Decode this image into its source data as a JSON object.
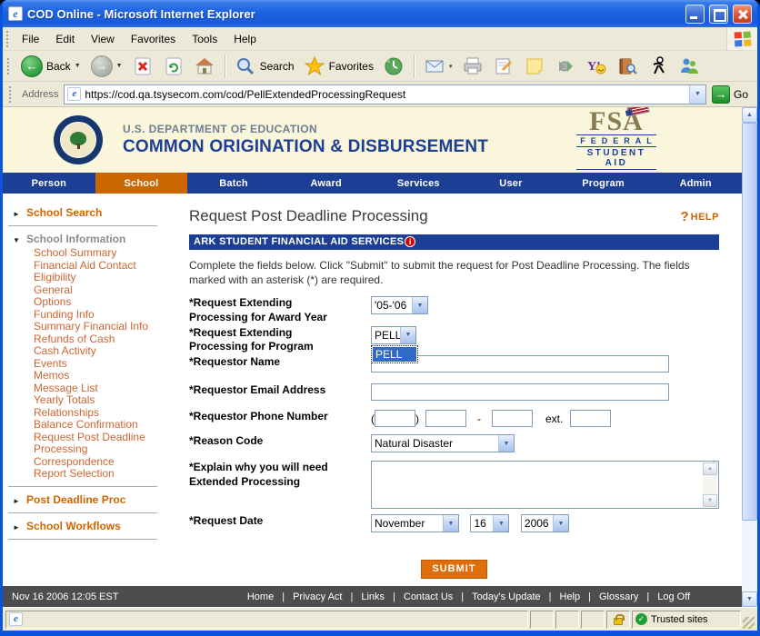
{
  "icons": {
    "chevron_down": "▼",
    "arrow_up": "▲",
    "arrow_down": "▼",
    "arrow_right": "►",
    "dropdown_small": "▾",
    "back_arrow": "←",
    "forward_arrow": "→",
    "go_arrow": "→",
    "check": "✓",
    "info_glyph": "i",
    "help_glyph": "?",
    "ie_glyph": "e"
  },
  "colors": {
    "nav_blue": "#1C3E94",
    "accent_orange": "#CC6600",
    "submit_orange": "#DF6E0B",
    "selection_blue": "#316AC5",
    "footer_gray": "#4D4D4D",
    "banner_cream": "#FAF6DC"
  },
  "window": {
    "title": "COD Online - Microsoft Internet Explorer",
    "menu": [
      "File",
      "Edit",
      "View",
      "Favorites",
      "Tools",
      "Help"
    ],
    "toolbar": {
      "back_label": "Back",
      "search_label": "Search",
      "favorites_label": "Favorites"
    },
    "address": {
      "label": "Address",
      "value": "https://cod.qa.tsysecom.com/cod/PellExtendedProcessingRequest",
      "go_label": "Go"
    },
    "status": {
      "trusted_label": "Trusted sites"
    }
  },
  "banner": {
    "dept": "U.S. DEPARTMENT OF EDUCATION",
    "app": "COMMON ORIGINATION & DISBURSEMENT",
    "fsa_acronym": "FSA",
    "fsa_line1": "FEDERAL",
    "fsa_line2": "STUDENT AID"
  },
  "nav": {
    "items": [
      {
        "label": "Person"
      },
      {
        "label": "School",
        "active": true
      },
      {
        "label": "Batch"
      },
      {
        "label": "Award"
      },
      {
        "label": "Services"
      },
      {
        "label": "User"
      },
      {
        "label": "Program"
      },
      {
        "label": "Admin"
      }
    ]
  },
  "sidebar": {
    "sections": [
      {
        "label": "School Search",
        "expanded": false
      },
      {
        "label": "School Information",
        "expanded": true,
        "items": [
          "School Summary",
          "Financial Aid Contact",
          "Eligibility",
          "General",
          "Options",
          "Funding Info",
          "Summary Financial Info",
          "Refunds of Cash",
          "Cash Activity",
          "Events",
          "Memos",
          "Message List",
          "Yearly Totals",
          "Relationships",
          "Balance Confirmation",
          "Request Post Deadline Processing",
          "Correspondence",
          "Report Selection"
        ]
      },
      {
        "label": "Post Deadline Proc",
        "expanded": false
      },
      {
        "label": "School Workflows",
        "expanded": false
      }
    ]
  },
  "main": {
    "page_title": "Request Post Deadline Processing",
    "help_label": "HELP",
    "school_banner": "ARK STUDENT FINANCIAL AID SERVICES",
    "instructions": "Complete the fields below. Click \"Submit\" to submit the request for Post Deadline Processing. The fields marked with an asterisk (*) are required.",
    "fields": {
      "award_year": {
        "label": "*Request Extending Processing for Award Year",
        "value": "'05-'06"
      },
      "program": {
        "label": "*Request Extending Processing for Program",
        "value": "PELL",
        "open_option": "PELL"
      },
      "requestor_name": {
        "label": "*Requestor Name",
        "value": ""
      },
      "requestor_email": {
        "label": "*Requestor Email Address",
        "value": ""
      },
      "requestor_phone": {
        "label": "*Requestor Phone Number",
        "open_paren": "(",
        "close_paren": ")",
        "dash": "-",
        "ext_label": "ext.",
        "area": "",
        "prefix": "",
        "line": "",
        "ext": ""
      },
      "reason_code": {
        "label": "*Reason Code",
        "value": "Natural Disaster"
      },
      "explain": {
        "label": "*Explain why you will need Extended Processing",
        "value": ""
      },
      "request_date": {
        "label": "*Request Date",
        "month": "November",
        "day": "16",
        "year": "2006"
      }
    },
    "submit_label": "SUBMIT"
  },
  "footer": {
    "timestamp": "Nov 16 2006 12:05 EST",
    "separator": "|",
    "links": [
      "Home",
      "Privacy Act",
      "Links",
      "Contact Us",
      "Today's Update",
      "Help",
      "Glossary",
      "Log Off"
    ]
  }
}
